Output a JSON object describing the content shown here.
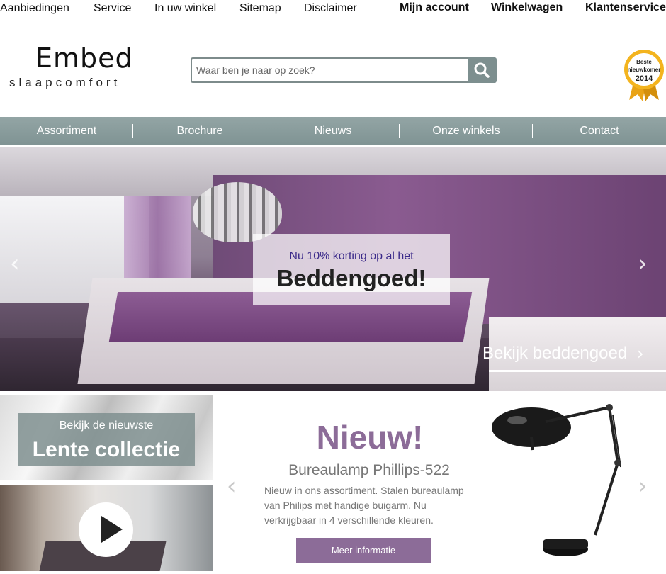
{
  "toplinks": {
    "left": [
      "Aanbiedingen",
      "Service",
      "In uw winkel",
      "Sitemap",
      "Disclaimer"
    ],
    "right": [
      "Mijn account",
      "Winkelwagen",
      "Klantenservice"
    ]
  },
  "logo": {
    "brand": "Embed",
    "sub": "slaapcomfort"
  },
  "search": {
    "placeholder": "Waar ben je naar op zoek?"
  },
  "badge": {
    "line1": "Beste",
    "line2": "nieuwkomer",
    "year": "2014"
  },
  "nav": [
    "Assortiment",
    "Brochure",
    "Nieuws",
    "Onze winkels",
    "Contact"
  ],
  "hero": {
    "promo_small": "Nu 10% korting op al het",
    "promo_big": "Beddengoed!",
    "cta": "Bekijk beddengoed"
  },
  "tile_collection": {
    "small": "Bekijk de nieuwste",
    "big": "Lente collectie"
  },
  "product": {
    "heading": "Nieuw!",
    "name": "Bureaulamp Phillips-522",
    "description": "Nieuw in ons assortiment. Stalen bureaulamp van Philips met handige buigarm. Nu verkrijgbaar in 4 verschillende kleuren.",
    "button": "Meer informatie"
  },
  "colors": {
    "accent_purple": "#8c6c98",
    "nav_grey": "#7f9393"
  }
}
